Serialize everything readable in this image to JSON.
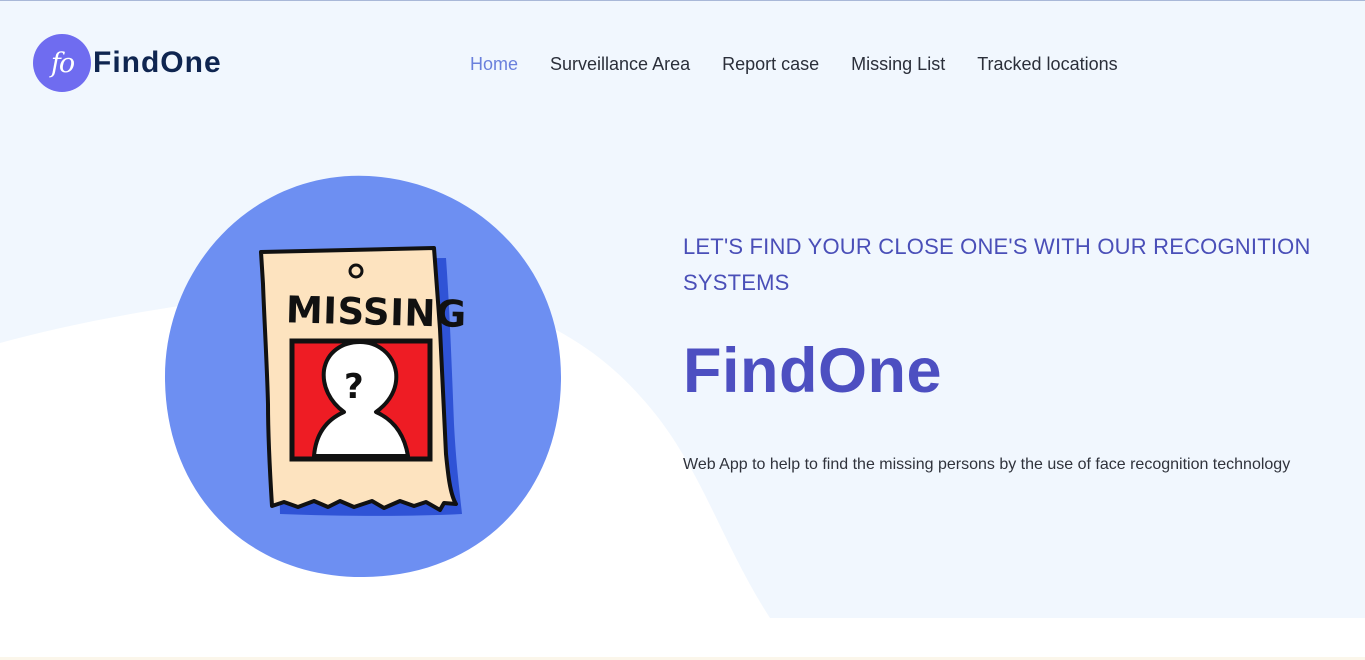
{
  "brand": {
    "logo_monogram": "fo",
    "name": "FindOne"
  },
  "nav": {
    "items": [
      {
        "label": "Home",
        "active": true
      },
      {
        "label": "Surveillance Area",
        "active": false
      },
      {
        "label": "Report case",
        "active": false
      },
      {
        "label": "Missing List",
        "active": false
      },
      {
        "label": "Tracked locations",
        "active": false
      }
    ]
  },
  "hero": {
    "tagline": "LET'S FIND YOUR CLOSE ONE'S WITH OUR RECOGNITION SYSTEMS",
    "title": "FindOne",
    "description": "Web App to help to find the missing persons by the use of face recognition technology",
    "illustration": {
      "icon": "missing-poster-icon",
      "poster_text": "MISSING",
      "question_mark": "?"
    }
  },
  "colors": {
    "accent": "#6f6cf0",
    "active_nav": "#6a80dc",
    "title": "#4d4fc1",
    "hero_bg": "#f1f7fe",
    "circle": "#6d8ff2",
    "poster_red": "#ee1c24",
    "poster_paper": "#fde3bf"
  }
}
